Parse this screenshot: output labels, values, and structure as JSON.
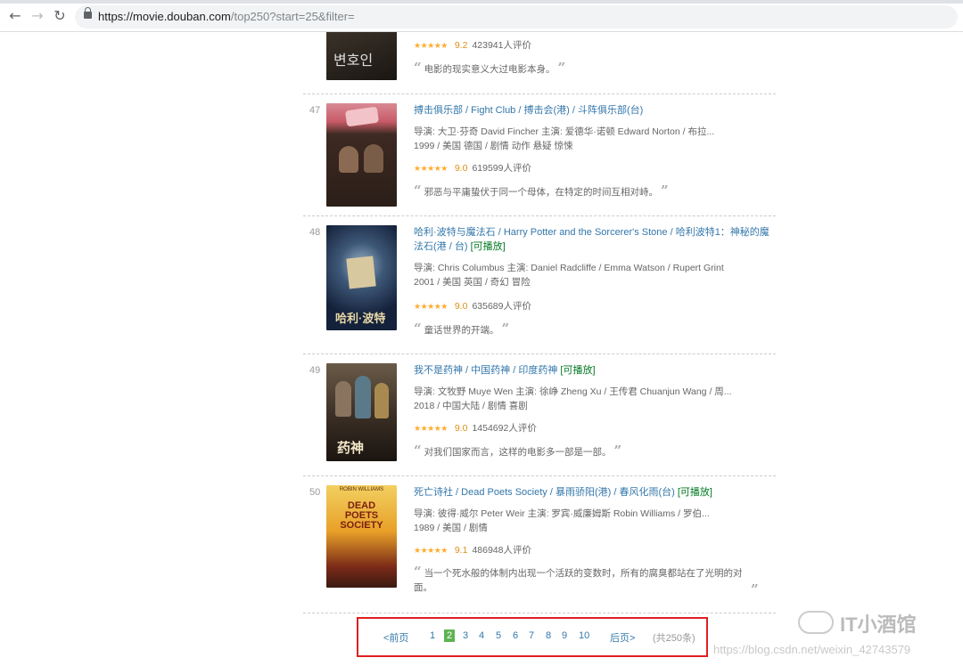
{
  "browser": {
    "url_host": "https://movie.douban.com",
    "url_path": "/top250?start=25&filter="
  },
  "movies": [
    {
      "rank": "",
      "title": "",
      "others": "",
      "playable": "",
      "meta1": "",
      "meta2": "",
      "score": "9.2",
      "votes": "423941人评价",
      "quote": "电影的现实意义大过电影本身。",
      "poster_color": "#2a241e"
    },
    {
      "rank": "47",
      "title": "搏击俱乐部",
      "others": " / Fight Club  / 搏击会(港) / 斗阵俱乐部(台)",
      "playable": "",
      "meta1": "导演: 大卫·芬奇 David Fincher   主演: 爱德华·诺顿 Edward Norton / 布拉...",
      "meta2": "1999 / 美国 德国 / 剧情 动作 悬疑 惊悚",
      "score": "9.0",
      "votes": "619599人评价",
      "quote": "邪恶与平庸蛰伏于同一个母体，在特定的时间互相对峙。",
      "poster_color": "#3b2a22"
    },
    {
      "rank": "48",
      "title": "哈利·波特与魔法石",
      "others": " / Harry Potter and the Sorcerer's Stone  / 哈利波特1：神秘的魔法石(港 / 台)",
      "playable": "[可播放]",
      "meta1": "导演: Chris Columbus   主演: Daniel Radcliffe / Emma Watson / Rupert Grint",
      "meta2": "2001 / 美国 英国 / 奇幻 冒险",
      "score": "9.0",
      "votes": "635689人评价",
      "quote": "童话世界的开端。",
      "poster_color": "#1d2c45"
    },
    {
      "rank": "49",
      "title": "我不是药神",
      "others": " / 中国药神 / 印度药神",
      "playable": "[可播放]",
      "meta1": "导演: 文牧野 Muye Wen   主演: 徐峥 Zheng Xu / 王传君 Chuanjun Wang / 周...",
      "meta2": "2018 / 中国大陆 / 剧情 喜剧",
      "score": "9.0",
      "votes": "1454692人评价",
      "quote": "对我们国家而言，这样的电影多一部是一部。",
      "poster_color": "#3a2f26"
    },
    {
      "rank": "50",
      "title": "死亡诗社",
      "others": " / Dead Poets Society  / 暴雨骄阳(港) / 春风化雨(台)",
      "playable": "[可播放]",
      "meta1": "导演: 彼得·威尔 Peter Weir   主演: 罗宾·威廉姆斯 Robin Williams / 罗伯...",
      "meta2": "1989 / 美国 / 剧情",
      "score": "9.1",
      "votes": "486948人评价",
      "quote": "当一个死水般的体制内出现一个活跃的变数时，所有的腐臭都站在了光明的对面。",
      "poster_color": "#e8a028"
    }
  ],
  "pager": {
    "prev": "<前页",
    "pages": [
      "1",
      "2",
      "3",
      "4",
      "5",
      "6",
      "7",
      "8",
      "9",
      "10"
    ],
    "next": "后页>",
    "count": "(共250条)"
  },
  "watermark": {
    "brand": "IT小酒馆",
    "url": "https://blog.csdn.net/weixin_42743579"
  },
  "colors": {
    "link": "#3377aa",
    "star": "#ffac2d",
    "current_page": "#5fb352",
    "highlight_box": "#e02020"
  }
}
